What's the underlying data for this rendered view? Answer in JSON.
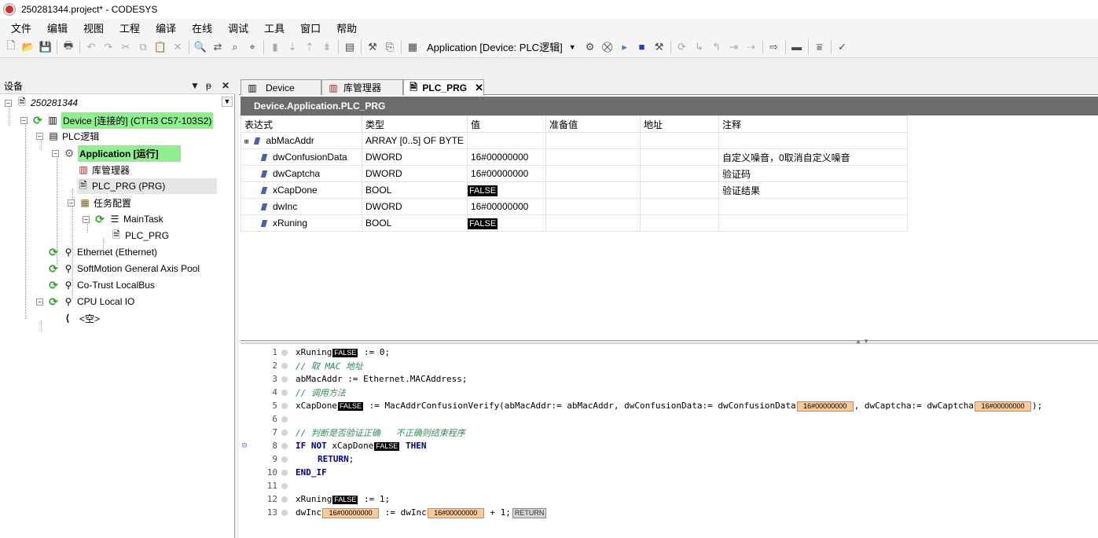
{
  "window": {
    "title": "250281344.project* - CODESYS"
  },
  "menu": [
    "文件",
    "编辑",
    "视图",
    "工程",
    "编译",
    "在线",
    "调试",
    "工具",
    "窗口",
    "帮助"
  ],
  "toolbar": {
    "application_selector": "Application [Device: PLC逻辑]"
  },
  "device_panel": {
    "title": "设备",
    "tree": [
      {
        "label": "250281344",
        "italic": true
      },
      {
        "label": "Device [连接的] (CTH3 C57-103S2)",
        "highlight": true
      },
      {
        "label": "PLC逻辑"
      },
      {
        "label": "Application [运行]",
        "highlight": true,
        "bold": true
      },
      {
        "label": "库管理器"
      },
      {
        "label": "PLC_PRG (PRG)",
        "selected": true
      },
      {
        "label": "任务配置"
      },
      {
        "label": "MainTask"
      },
      {
        "label": "PLC_PRG"
      },
      {
        "label": "Ethernet (Ethernet)"
      },
      {
        "label": "SoftMotion General Axis Pool"
      },
      {
        "label": "Co-Trust LocalBus"
      },
      {
        "label": "CPU Local IO"
      },
      {
        "label": "<空>"
      }
    ]
  },
  "tabs": [
    {
      "label": "Device",
      "icon": "device-icon"
    },
    {
      "label": "库管理器",
      "icon": "library-icon"
    },
    {
      "label": "PLC_PRG",
      "icon": "program-icon",
      "active": true
    }
  ],
  "editor": {
    "path": "Device.Application.PLC_PRG",
    "columns": [
      "表达式",
      "类型",
      "值",
      "准备值",
      "地址",
      "注释"
    ],
    "variables": [
      {
        "name": "abMacAddr",
        "type": "ARRAY [0..5] OF BYTE",
        "value": "",
        "prepared": "",
        "address": "",
        "comment": "",
        "expandable": true
      },
      {
        "name": "dwConfusionData",
        "type": "DWORD",
        "value": "16#00000000",
        "prepared": "",
        "address": "",
        "comment": "自定义噪音，0取消自定义噪音"
      },
      {
        "name": "dwCaptcha",
        "type": "DWORD",
        "value": "16#00000000",
        "prepared": "",
        "address": "",
        "comment": "验证码"
      },
      {
        "name": "xCapDone",
        "type": "BOOL",
        "value": "FALSE",
        "prepared": "",
        "address": "",
        "comment": "验证结果",
        "bool": true
      },
      {
        "name": "dwInc",
        "type": "DWORD",
        "value": "16#00000000",
        "prepared": "",
        "address": "",
        "comment": ""
      },
      {
        "name": "xRuning",
        "type": "BOOL",
        "value": "FALSE",
        "prepared": "",
        "address": "",
        "comment": "",
        "bool": true
      }
    ]
  },
  "code": {
    "line_numbers": [
      "1",
      "2",
      "3",
      "4",
      "5",
      "6",
      "7",
      "8",
      "9",
      "10",
      "11",
      "12",
      "13"
    ],
    "l1_a": "xRuning",
    "l1_v": "FALSE",
    "l1_b": " := 0;",
    "l2": "// 取 MAC 地址",
    "l3": "abMacAddr := Ethernet.MACAddress;",
    "l4": "// 调用方法",
    "l5_a": "xCapDone",
    "l5_v1": "FALSE",
    "l5_b": " := MacAddrConfusionVerify(abMacAddr:= abMacAddr, dwConfusionData:= dwConfusionData",
    "l5_v2": "16#00000000",
    "l5_c": ", dwCaptcha:= dwCaptcha",
    "l5_v3": "16#00000000",
    "l5_d": ");",
    "l7": "// 判断是否验证正确   不正确则结束程序",
    "l8_kw1": "IF NOT",
    "l8_a": " xCapDone",
    "l8_v": "FALSE",
    "l8_kw2": "THEN",
    "l9_kw": "RETURN",
    "l9_b": ";",
    "l10_kw": "END_IF",
    "l12_a": "xRuning",
    "l12_v": "FALSE",
    "l12_b": " := 1;",
    "l13_a": "dwInc",
    "l13_v1": "16#00000000",
    "l13_b": " := dwInc",
    "l13_v2": "16#00000000",
    "l13_c": " + 1;",
    "l13_ret": "RETURN"
  }
}
